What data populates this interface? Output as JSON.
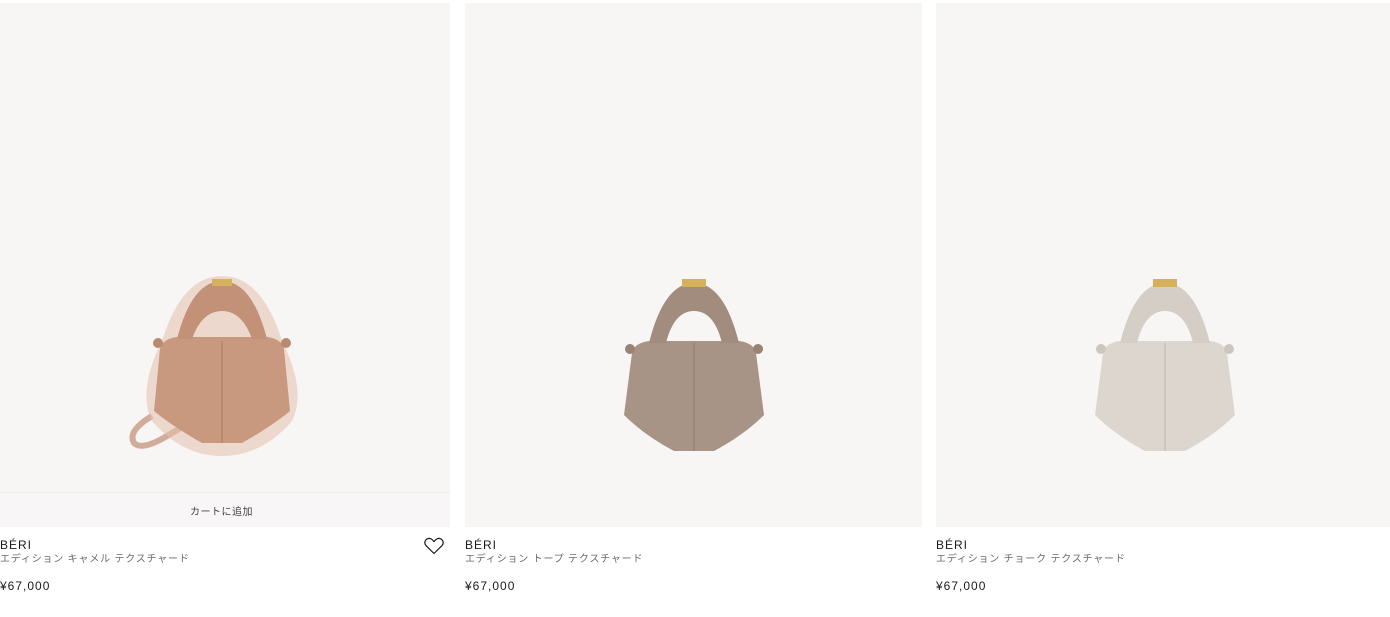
{
  "products": [
    {
      "brand": "BÉRI",
      "variant": "エディション キャメル テクスチャード",
      "price": "¥67,000",
      "cart_label": "カートに追加",
      "color": "#c79a82",
      "shade": "#b8876d",
      "wishlist_icon": "heart-icon"
    },
    {
      "brand": "BÉRI",
      "variant": "エディション トープ テクスチャード",
      "price": "¥67,000",
      "color": "#a89486",
      "shade": "#978273"
    },
    {
      "brand": "BÉRI",
      "variant": "エディション チョーク テクスチャード",
      "price": "¥67,000",
      "color": "#dcd6cf",
      "shade": "#cdc6be"
    }
  ],
  "accent": {
    "hardware": "#d4b15a"
  }
}
